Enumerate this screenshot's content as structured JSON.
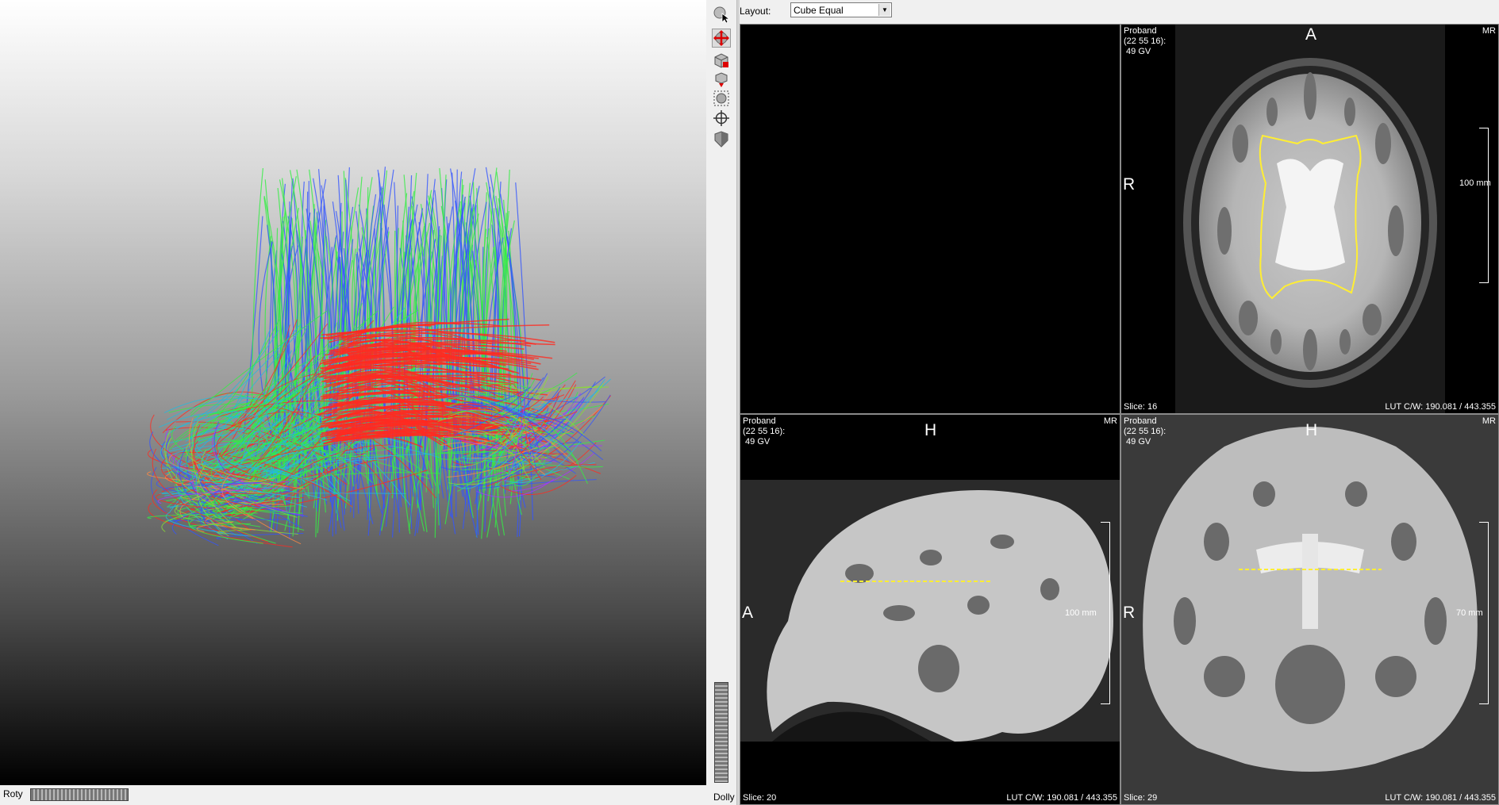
{
  "toolbar": {
    "buttons": [
      {
        "icon": "pointer-icon"
      },
      {
        "icon": "rotate-icon",
        "active": true
      },
      {
        "icon": "cube-cut-icon"
      },
      {
        "icon": "cube-down-icon"
      },
      {
        "icon": "select-region-icon"
      },
      {
        "icon": "crosshair-icon"
      },
      {
        "icon": "shield-icon"
      }
    ],
    "dolly_label": "Dolly"
  },
  "view3d": {
    "roty_label": "Roty"
  },
  "layout": {
    "label": "Layout:",
    "value": "Cube Equal"
  },
  "viewports": {
    "axial": {
      "info": [
        "Proband",
        "(22 55 16):",
        " 49 GV"
      ],
      "modality": "MR",
      "top": "A",
      "left": "R",
      "scale": "100 mm",
      "slice": "Slice: 16",
      "lut": "LUT C/W: 190.081 / 443.355"
    },
    "sagittal": {
      "info": [
        "Proband",
        "(22 55 16):",
        " 49 GV"
      ],
      "modality": "MR",
      "top": "H",
      "left": "A",
      "scale": "100 mm",
      "slice": "Slice: 20",
      "lut": "LUT C/W: 190.081 / 443.355"
    },
    "coronal": {
      "info": [
        "Proband",
        "(22 55 16):",
        " 49 GV"
      ],
      "modality": "MR",
      "top": "H",
      "left": "R",
      "scale": "70 mm",
      "slice": "Slice: 29",
      "lut": "LUT C/W: 190.081 / 443.355"
    }
  },
  "colors": {
    "contour": "#ffee33",
    "fiber_lr": "#ff2a20",
    "fiber_ap": "#33ee44",
    "fiber_si": "#3355ff"
  }
}
